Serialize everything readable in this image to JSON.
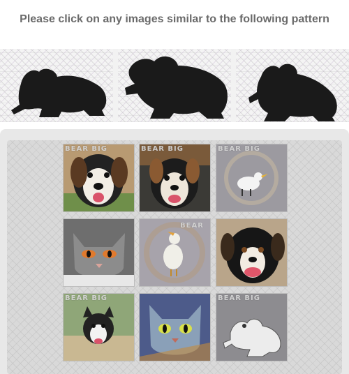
{
  "instruction": "Please click on any images similar to the following pattern",
  "pattern": {
    "tiles": [
      {
        "name": "frog-silhouette-1"
      },
      {
        "name": "frog-silhouette-2"
      },
      {
        "name": "frog-silhouette-3"
      }
    ]
  },
  "grid": {
    "tiles": [
      {
        "subject": "dog",
        "watermark": "BEAR BIG"
      },
      {
        "subject": "dog",
        "watermark": "BEAR BIG"
      },
      {
        "subject": "bird",
        "watermark": "BEAR BIG"
      },
      {
        "subject": "cat",
        "watermark": ""
      },
      {
        "subject": "bird",
        "watermark": "BEAR"
      },
      {
        "subject": "dog",
        "watermark": ""
      },
      {
        "subject": "dog",
        "watermark": "BEAR BIG"
      },
      {
        "subject": "cat",
        "watermark": ""
      },
      {
        "subject": "frog",
        "watermark": "BEAR BIG"
      }
    ]
  },
  "colors": {
    "instruction_text": "#6a6a6a",
    "panel_bg": "#e8e8e8",
    "silhouette": "#1a1a1a"
  }
}
